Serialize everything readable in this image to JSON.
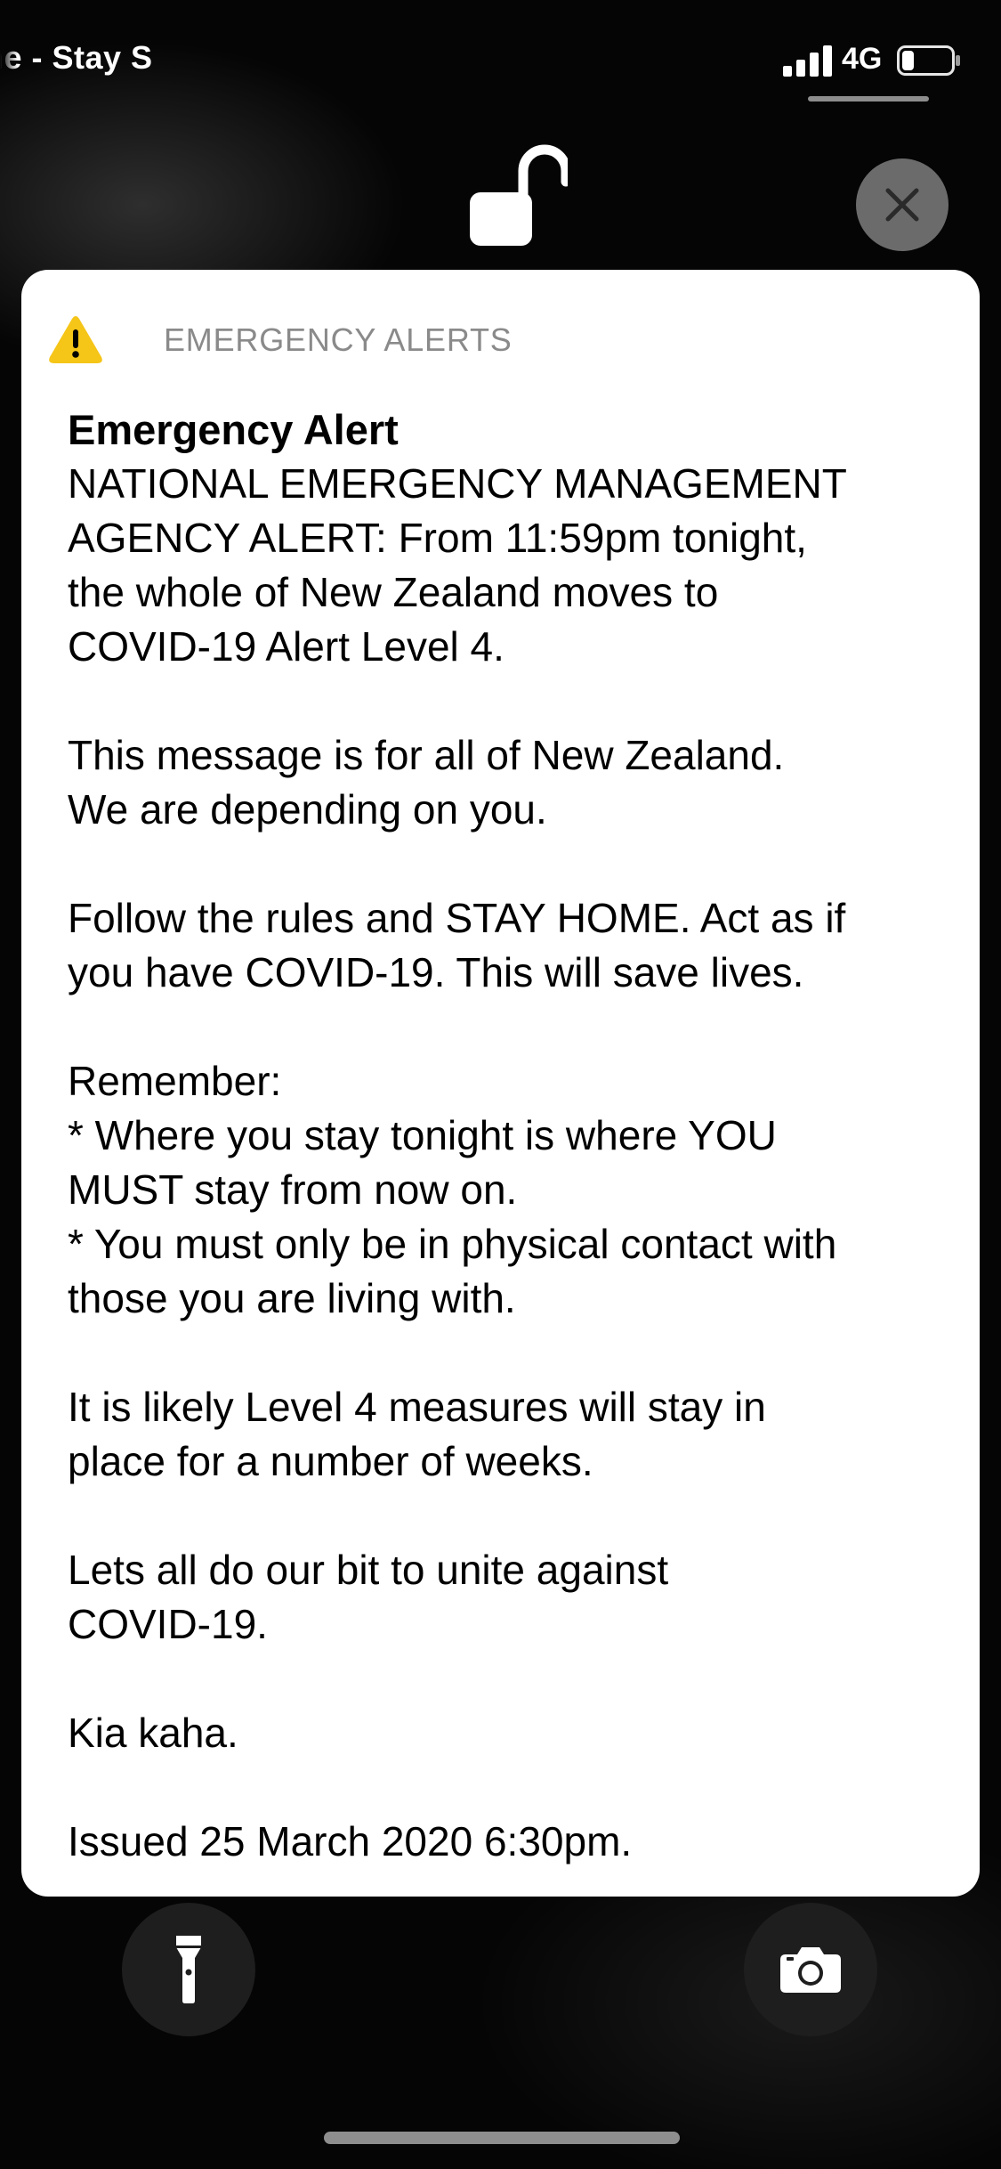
{
  "status_bar": {
    "carrier": "ne - Stay S",
    "network": "4G",
    "battery_level": 0.2,
    "signal_bars": 4
  },
  "lock_screen": {
    "lock_state": "unlocked",
    "close_icon": "close-icon",
    "flashlight_icon": "flashlight-icon",
    "camera_icon": "camera-icon"
  },
  "alert": {
    "category": "EMERGENCY ALERTS",
    "icon": "warning-icon",
    "icon_color": "#F5C518",
    "title": "Emergency Alert",
    "paragraphs": [
      [
        "NATIONAL EMERGENCY MANAGEMENT",
        "AGENCY ALERT: From 11:59pm tonight,",
        "the whole of New Zealand moves to",
        "COVID-19 Alert Level 4."
      ],
      [
        "This message is for all of New Zealand.",
        "We are depending on you."
      ],
      [
        "Follow the rules and STAY HOME. Act as if",
        "you have COVID-19. This will save lives."
      ],
      [
        "Remember:",
        "* Where you stay tonight is where YOU",
        "MUST stay from now on.",
        "* You must only be in physical contact with",
        "those you are living with."
      ],
      [
        "It is likely Level 4 measures will stay in",
        "place for a number of weeks."
      ],
      [
        "Lets all do our bit to unite against",
        "COVID-19."
      ],
      [
        "Kia kaha."
      ],
      [
        "Issued 25 March 2020 6:30pm."
      ]
    ]
  },
  "colors": {
    "card_background": "#FFFFFF",
    "category_text": "#8A8A8A",
    "screen_background": "#000000"
  }
}
